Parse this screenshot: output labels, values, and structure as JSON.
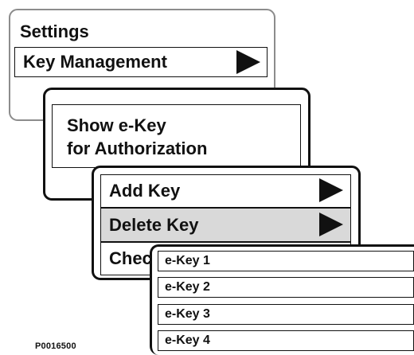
{
  "settings_panel": {
    "title": "Settings",
    "key_management_label": "Key Management"
  },
  "key_panel": {
    "show_ekey_line1": "Show e-Key",
    "show_ekey_line2": "for Authorization"
  },
  "key_menu": {
    "add_key_label": "Add Key",
    "delete_key_label": "Delete Key",
    "check_key_label": "Chec"
  },
  "ekey_list": {
    "items": [
      {
        "label": "e-Key 1"
      },
      {
        "label": "e-Key 2"
      },
      {
        "label": "e-Key 3"
      },
      {
        "label": "e-Key 4"
      }
    ]
  },
  "figure_id": "P0016500",
  "colors": {
    "selected_row": "#d9d9d9",
    "settings_border": "#8c8c8c",
    "border": "#111111"
  }
}
